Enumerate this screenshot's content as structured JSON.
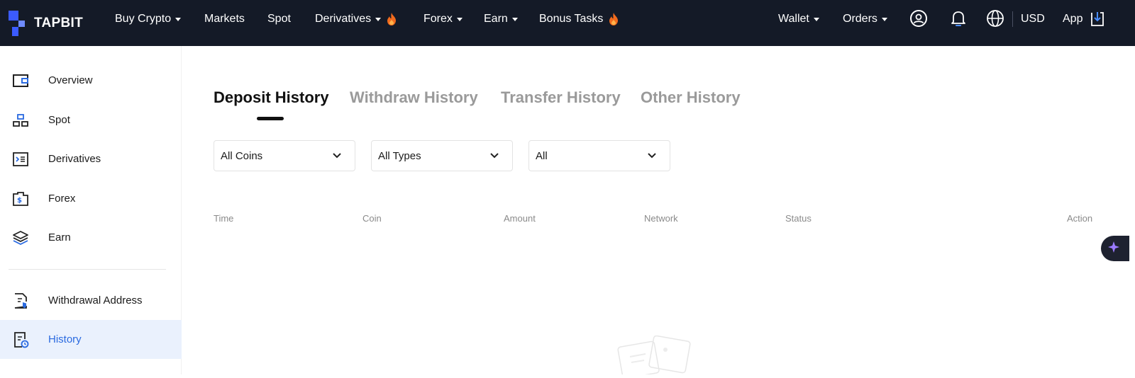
{
  "brand": {
    "name": "TAPBIT",
    "colors": {
      "topbar": "#141a27",
      "accent": "#2a6ae0",
      "logo_blue": "#3b5bff",
      "fire": "#f26b1d"
    }
  },
  "topnav": {
    "items": [
      {
        "label": "Buy Crypto",
        "has_dropdown": true
      },
      {
        "label": "Markets"
      },
      {
        "label": "Spot"
      },
      {
        "label": "Derivatives",
        "has_dropdown": true,
        "icon": "fire-icon"
      },
      {
        "label": "Forex",
        "has_dropdown": true
      },
      {
        "label": "Earn",
        "has_dropdown": true
      },
      {
        "label": "Bonus Tasks",
        "icon": "fire-icon"
      }
    ],
    "right": {
      "wallet": "Wallet",
      "orders": "Orders",
      "icons": [
        "user-icon",
        "bell-icon",
        "globe-icon"
      ],
      "currency": "USD",
      "app": "App",
      "app_icon": "download-icon"
    }
  },
  "sidebar": {
    "items": [
      {
        "label": "Overview",
        "icon": "wallet-icon"
      },
      {
        "label": "Spot",
        "icon": "spot-icon"
      },
      {
        "label": "Derivatives",
        "icon": "derivatives-icon"
      },
      {
        "label": "Forex",
        "icon": "forex-icon"
      },
      {
        "label": "Earn",
        "icon": "layers-icon"
      },
      {
        "label": "Withdrawal Address",
        "icon": "address-shield-icon"
      },
      {
        "label": "History",
        "icon": "history-icon",
        "active": true
      }
    ]
  },
  "main": {
    "tabs": [
      {
        "label": "Deposit History",
        "active": true
      },
      {
        "label": "Withdraw History"
      },
      {
        "label": "Transfer History"
      },
      {
        "label": "Other History"
      }
    ],
    "filters": [
      {
        "value": "All Coins"
      },
      {
        "value": "All Types"
      },
      {
        "value": "All"
      }
    ],
    "table": {
      "columns": [
        "Time",
        "Coin",
        "Amount",
        "Network",
        "Status",
        "Action"
      ],
      "rows": []
    }
  }
}
